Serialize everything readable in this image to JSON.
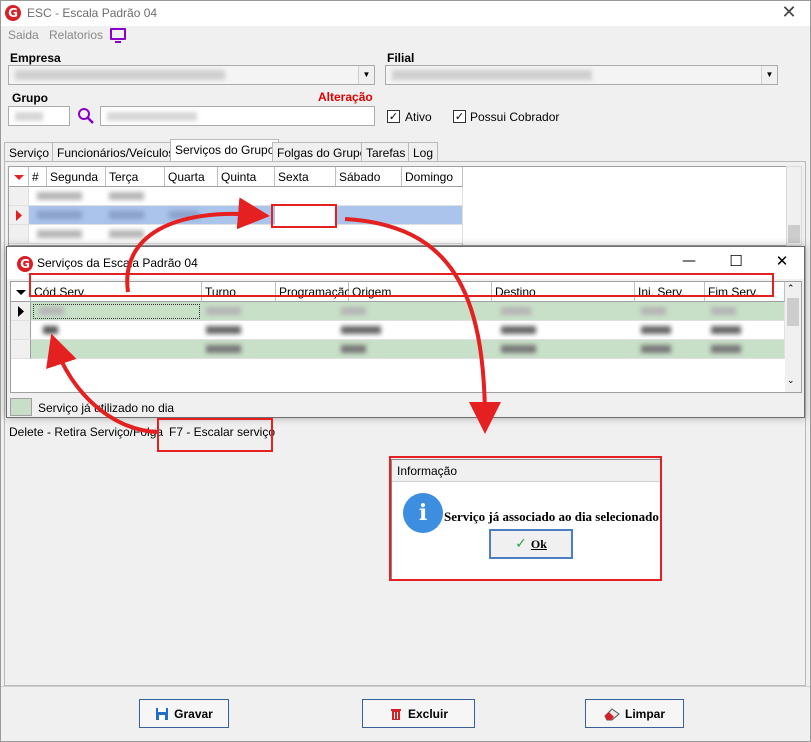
{
  "window": {
    "title": "ESC - Escala Padrão 04"
  },
  "menu": [
    {
      "label": "Saida"
    },
    {
      "label": "Relatorios"
    }
  ],
  "form": {
    "empresa_label": "Empresa",
    "filial_label": "Filial",
    "grupo_label": "Grupo",
    "alteracao_label": "Alteração",
    "ativo_label": "Ativo",
    "ativo_checked": "✓",
    "possui_cobrador_label": "Possui Cobrador",
    "possui_cobrador_checked": "✓"
  },
  "tabs": [
    {
      "label": "Serviço"
    },
    {
      "label": "Funcionários/Veículos"
    },
    {
      "label": "Serviços do Grupo"
    },
    {
      "label": "Folgas do Grupo"
    },
    {
      "label": "Tarefas"
    },
    {
      "label": "Log"
    }
  ],
  "grid1": {
    "headers": [
      "#",
      "Segunda",
      "Terça",
      "Quarta",
      "Quinta",
      "Sexta",
      "Sábado",
      "Domingo"
    ]
  },
  "dialog": {
    "title": "Serviços da Escala Padrão 04",
    "headers": [
      "Cód.Serv.",
      "Turno",
      "Programação",
      "Origem",
      "Destino",
      "Ini. Serv.",
      "Fim Serv."
    ],
    "legend": "Serviço já utilizado no dia",
    "min_icon": "—",
    "max_icon": "☐",
    "close_icon": "✕"
  },
  "hints": {
    "delete": "Delete - Retira Serviço/Folga",
    "f7": "F7 - Escalar serviço"
  },
  "info": {
    "title": "Informação",
    "message": "Serviço já associado ao dia selecionado!",
    "ok_label": "Ok"
  },
  "buttons": {
    "gravar": "Gravar",
    "excluir": "Excluir",
    "limpar": "Limpar"
  }
}
